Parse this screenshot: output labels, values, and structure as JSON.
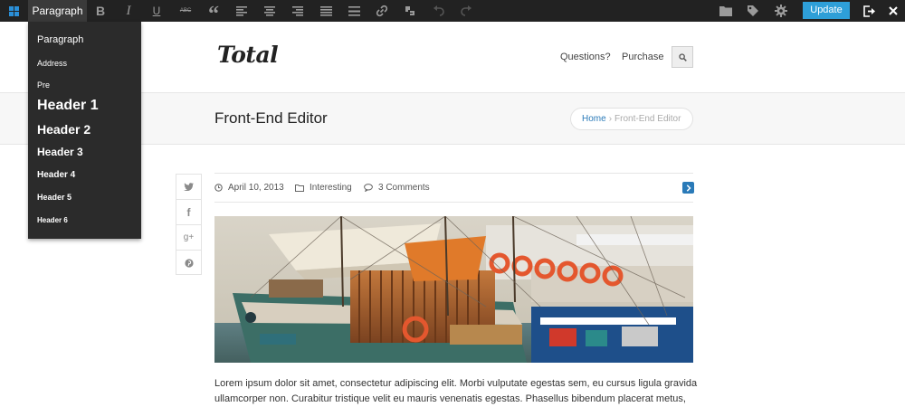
{
  "toolbar": {
    "format_selected": "Paragraph",
    "update_label": "Update",
    "icons": [
      "grid-icon",
      "bold-icon",
      "italic-icon",
      "underline-icon",
      "strikethrough-icon",
      "quote-icon",
      "align-left-icon",
      "align-center-icon",
      "align-right-icon",
      "align-justify-icon",
      "horizontal-rule-icon",
      "link-icon",
      "unlink-icon",
      "undo-icon",
      "redo-icon",
      "folder-icon",
      "tag-icon",
      "gear-icon",
      "exit-icon",
      "close-icon"
    ],
    "bold_glyph": "B",
    "italic_glyph": "I",
    "underline_glyph": "U",
    "strike_glyph": "ABC",
    "quote_glyph": "“"
  },
  "format_menu": {
    "items": [
      "Paragraph",
      "Address",
      "Pre",
      "Header 1",
      "Header 2",
      "Header 3",
      "Header 4",
      "Header 5",
      "Header 6"
    ]
  },
  "site": {
    "logo": "Total",
    "nav": [
      "Questions?",
      "Purchase"
    ]
  },
  "page": {
    "title": "Front-End Editor",
    "breadcrumb": {
      "home": "Home",
      "separator": "›",
      "current": "Front-End Editor"
    }
  },
  "share": {
    "twitter": "twitter-icon",
    "facebook_glyph": "f",
    "googleplus_glyph": "g+",
    "pinterest": "pinterest-icon"
  },
  "post": {
    "date": "April 10, 2013",
    "category": "Interesting",
    "comments": "3 Comments",
    "excerpt_line1": "Lorem ipsum dolor sit amet, consectetur adipiscing elit. Morbi vulputate egestas sem, eu cursus ligula gravida",
    "excerpt_line2": "ullamcorper non. Curabitur tristique velit eu mauris venenatis egestas. Phasellus bibendum placerat metus, sed"
  },
  "colors": {
    "toolbar_bg": "#222222",
    "accent": "#2e9fd8",
    "link": "#2a7ab8"
  }
}
